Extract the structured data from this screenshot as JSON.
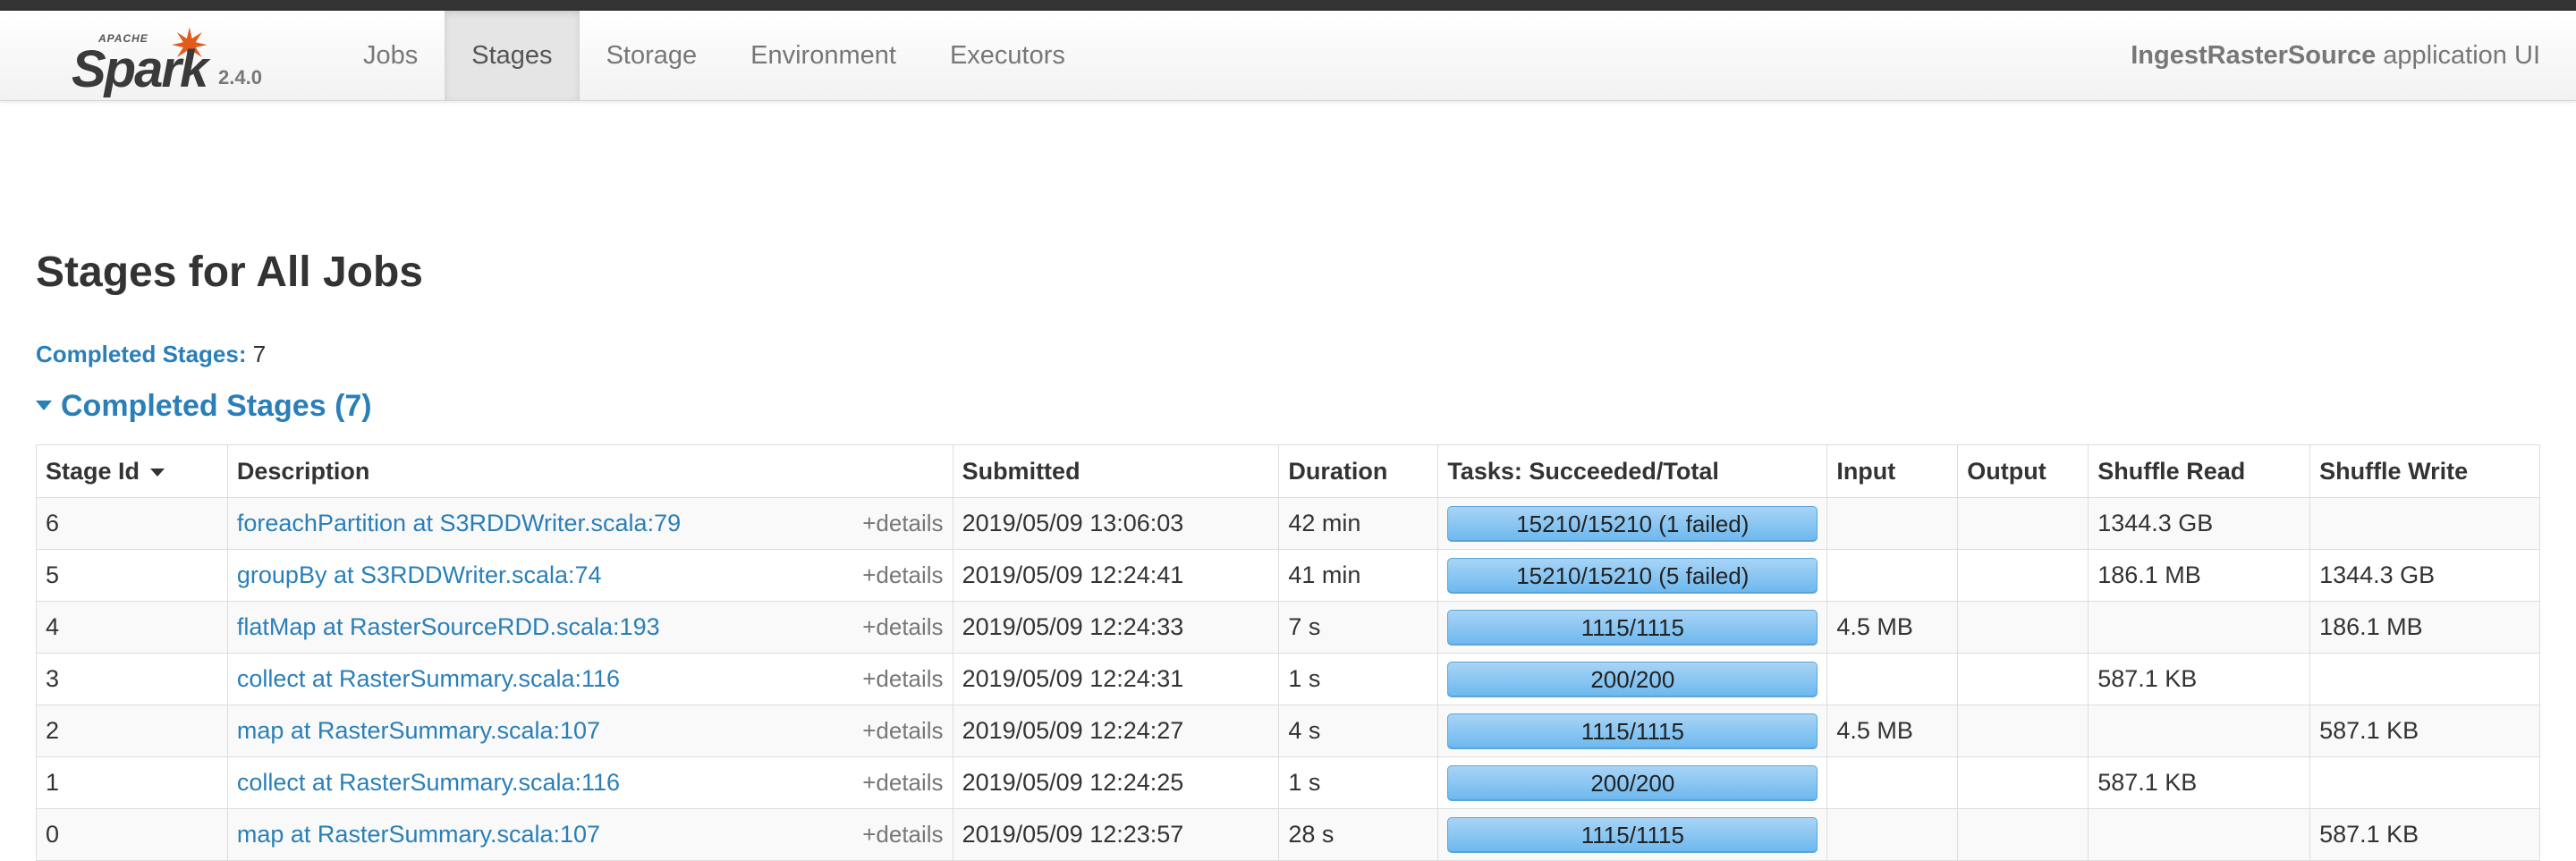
{
  "brand": {
    "apache": "APACHE",
    "name": "Spark",
    "version": "2.4.0"
  },
  "nav": {
    "tabs": [
      "Jobs",
      "Stages",
      "Storage",
      "Environment",
      "Executors"
    ],
    "active": "Stages"
  },
  "app": {
    "name": "IngestRasterSource",
    "suffix": "application UI"
  },
  "page": {
    "title": "Stages for All Jobs",
    "completed_label": "Completed Stages:",
    "completed_count": "7",
    "section_title": "Completed Stages (7)"
  },
  "table": {
    "headers": [
      "Stage Id",
      "Description",
      "Submitted",
      "Duration",
      "Tasks: Succeeded/Total",
      "Input",
      "Output",
      "Shuffle Read",
      "Shuffle Write"
    ],
    "details_label": "+details",
    "rows": [
      {
        "id": "6",
        "desc": "foreachPartition at S3RDDWriter.scala:79",
        "submitted": "2019/05/09 13:06:03",
        "duration": "42 min",
        "tasks": "15210/15210 (1 failed)",
        "input": "",
        "output": "",
        "shuffle_read": "1344.3 GB",
        "shuffle_write": ""
      },
      {
        "id": "5",
        "desc": "groupBy at S3RDDWriter.scala:74",
        "submitted": "2019/05/09 12:24:41",
        "duration": "41 min",
        "tasks": "15210/15210 (5 failed)",
        "input": "",
        "output": "",
        "shuffle_read": "186.1 MB",
        "shuffle_write": "1344.3 GB"
      },
      {
        "id": "4",
        "desc": "flatMap at RasterSourceRDD.scala:193",
        "submitted": "2019/05/09 12:24:33",
        "duration": "7 s",
        "tasks": "1115/1115",
        "input": "4.5 MB",
        "output": "",
        "shuffle_read": "",
        "shuffle_write": "186.1 MB"
      },
      {
        "id": "3",
        "desc": "collect at RasterSummary.scala:116",
        "submitted": "2019/05/09 12:24:31",
        "duration": "1 s",
        "tasks": "200/200",
        "input": "",
        "output": "",
        "shuffle_read": "587.1 KB",
        "shuffle_write": ""
      },
      {
        "id": "2",
        "desc": "map at RasterSummary.scala:107",
        "submitted": "2019/05/09 12:24:27",
        "duration": "4 s",
        "tasks": "1115/1115",
        "input": "4.5 MB",
        "output": "",
        "shuffle_read": "",
        "shuffle_write": "587.1 KB"
      },
      {
        "id": "1",
        "desc": "collect at RasterSummary.scala:116",
        "submitted": "2019/05/09 12:24:25",
        "duration": "1 s",
        "tasks": "200/200",
        "input": "",
        "output": "",
        "shuffle_read": "587.1 KB",
        "shuffle_write": ""
      },
      {
        "id": "0",
        "desc": "map at RasterSummary.scala:107",
        "submitted": "2019/05/09 12:23:57",
        "duration": "28 s",
        "tasks": "1115/1115",
        "input": "",
        "output": "",
        "shuffle_read": "",
        "shuffle_write": "587.1 KB"
      }
    ]
  },
  "colors": {
    "link": "#2a7fb8",
    "progress": "#6cb8ef",
    "spark_orange": "#e25a1c"
  }
}
